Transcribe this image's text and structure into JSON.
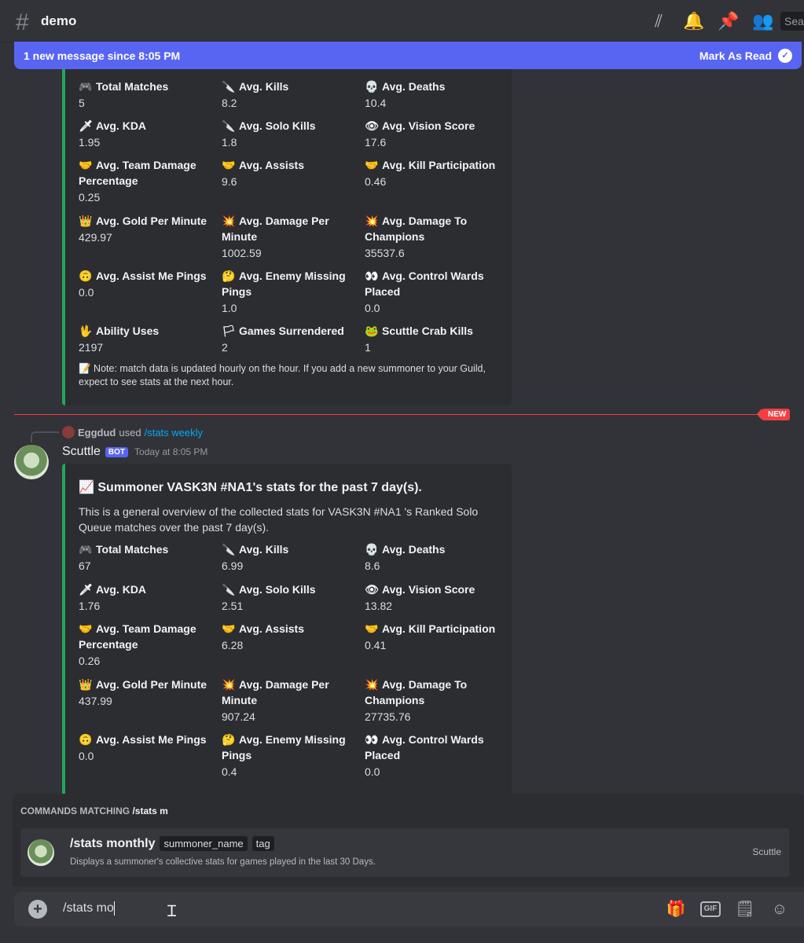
{
  "header": {
    "channel": "demo",
    "search_placeholder": "Sea"
  },
  "new_messages": {
    "text": "1 new message since 8:05 PM",
    "mark_read": "Mark As Read"
  },
  "embed1": {
    "fields": [
      {
        "emoji": "🎮",
        "name": "Total Matches",
        "value": "5"
      },
      {
        "emoji": "🔪",
        "name": "Avg. Kills",
        "value": "8.2"
      },
      {
        "emoji": "💀",
        "name": "Avg. Deaths",
        "value": "10.4"
      },
      {
        "emoji": "🗡",
        "name": "Avg. KDA",
        "value": "1.95"
      },
      {
        "emoji": "🔪",
        "name": "Avg. Solo Kills",
        "value": "1.8"
      },
      {
        "emoji": "👁",
        "name": "Avg. Vision Score",
        "value": "17.6"
      },
      {
        "emoji": "🤝",
        "name": "Avg. Team Damage Percentage",
        "value": "0.25"
      },
      {
        "emoji": "🤝",
        "name": "Avg. Assists",
        "value": "9.6"
      },
      {
        "emoji": "🤝",
        "name": "Avg. Kill Participation",
        "value": "0.46"
      },
      {
        "emoji": "👑",
        "name": "Avg. Gold Per Minute",
        "value": "429.97"
      },
      {
        "emoji": "💥",
        "name": "Avg. Damage Per Minute",
        "value": "1002.59"
      },
      {
        "emoji": "💥",
        "name": "Avg. Damage To Champions",
        "value": "35537.6"
      },
      {
        "emoji": "🙃",
        "name": "Avg. Assist Me Pings",
        "value": "0.0"
      },
      {
        "emoji": "🤔",
        "name": "Avg. Enemy Missing Pings",
        "value": "1.0"
      },
      {
        "emoji": "👀",
        "name": "Avg. Control Wards Placed",
        "value": "0.0"
      },
      {
        "emoji": "🖖",
        "name": "Ability Uses",
        "value": "2197"
      },
      {
        "emoji": "🏳",
        "name": "Games Surrendered",
        "value": "2"
      },
      {
        "emoji": "🐸",
        "name": "Scuttle Crab Kills",
        "value": "1"
      }
    ],
    "note": "📝 Note: match data is updated hourly on the hour. If you add a new summoner to your Guild, expect to see stats at the next hour."
  },
  "new_divider": "NEW",
  "message": {
    "reply_user": "Eggdud",
    "reply_used": "used",
    "reply_command": "/stats weekly",
    "author": "Scuttle",
    "bot_tag": "BOT",
    "timestamp": "Today at 8:05 PM",
    "embed_title": "📈 Summoner VASK3N #NA1's stats for the past 7 day(s).",
    "embed_desc": "This is a general overview of the collected stats for VASK3N #NA1 's Ranked Solo Queue matches over the past 7 day(s).",
    "fields": [
      {
        "emoji": "🎮",
        "name": "Total Matches",
        "value": "67"
      },
      {
        "emoji": "🔪",
        "name": "Avg. Kills",
        "value": "6.99"
      },
      {
        "emoji": "💀",
        "name": "Avg. Deaths",
        "value": "8.6"
      },
      {
        "emoji": "🗡",
        "name": "Avg. KDA",
        "value": "1.76"
      },
      {
        "emoji": "🔪",
        "name": "Avg. Solo Kills",
        "value": "2.51"
      },
      {
        "emoji": "👁",
        "name": "Avg. Vision Score",
        "value": "13.82"
      },
      {
        "emoji": "🤝",
        "name": "Avg. Team Damage Percentage",
        "value": "0.26"
      },
      {
        "emoji": "🤝",
        "name": "Avg. Assists",
        "value": "6.28"
      },
      {
        "emoji": "🤝",
        "name": "Avg. Kill Participation",
        "value": "0.41"
      },
      {
        "emoji": "👑",
        "name": "Avg. Gold Per Minute",
        "value": "437.99"
      },
      {
        "emoji": "💥",
        "name": "Avg. Damage Per Minute",
        "value": "907.24"
      },
      {
        "emoji": "💥",
        "name": "Avg. Damage To Champions",
        "value": "27735.76"
      },
      {
        "emoji": "🙃",
        "name": "Avg. Assist Me Pings",
        "value": "0.0"
      },
      {
        "emoji": "🤔",
        "name": "Avg. Enemy Missing Pings",
        "value": "0.4"
      },
      {
        "emoji": "👀",
        "name": "Avg. Control Wards Placed",
        "value": "0.0"
      }
    ]
  },
  "autocomplete": {
    "title_prefix": "COMMANDS MATCHING",
    "title_query": "/stats m",
    "command": "/stats monthly",
    "options": [
      "summoner_name",
      "tag"
    ],
    "description": "Displays a summoner's collective stats for games played in the last 30 Days.",
    "app": "Scuttle"
  },
  "composer": {
    "value": "/stats mo"
  }
}
